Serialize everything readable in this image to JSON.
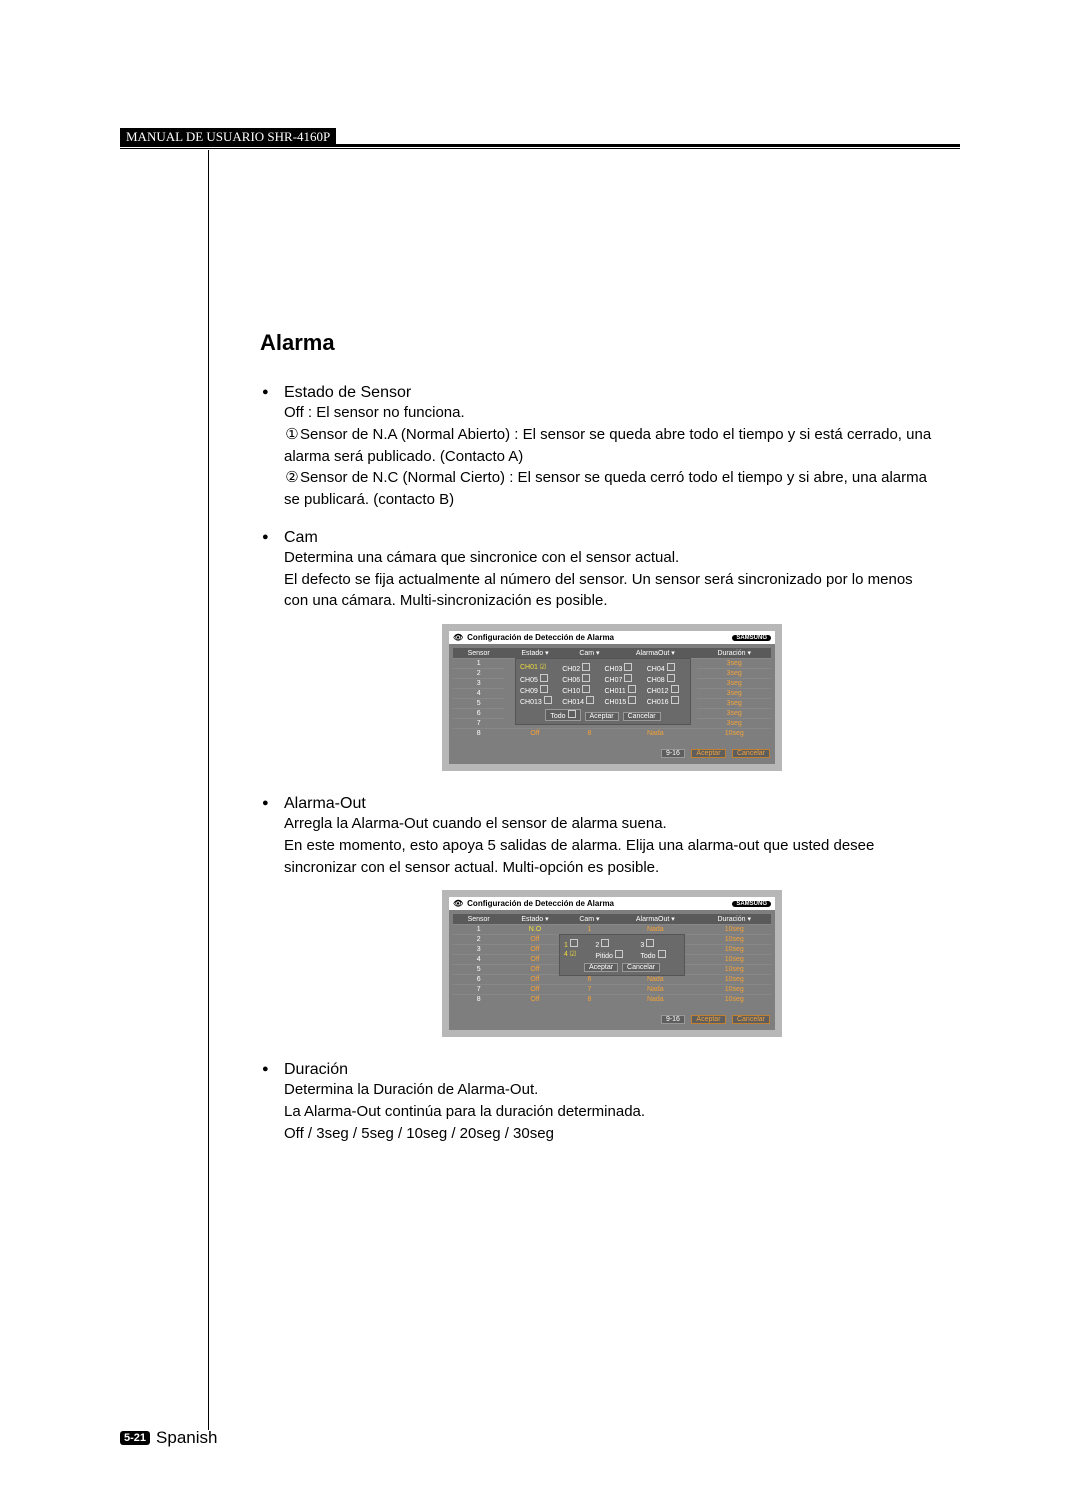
{
  "header": {
    "manual": "MANUAL DE USUARIO SHR-4160P"
  },
  "page": {
    "title": "Alarma",
    "footer_badge": "5-21",
    "footer_lang": "Spanish"
  },
  "sections": {
    "estado": {
      "heading": "Estado de Sensor",
      "off_line": "Off : El sensor no funciona.",
      "enum1_mark": "①",
      "enum1_text": "Sensor de N.A (Normal Abierto) : El sensor se queda abre todo el tiempo y si está cerrado, una alarma será publicado. (Contacto A)",
      "enum2_mark": "②",
      "enum2_text": "Sensor de N.C (Normal Cierto) : El sensor se queda cerró todo el tiempo y si abre, una alarma se publicará. (contacto B)"
    },
    "cam": {
      "heading": "Cam",
      "l1": "Determina una cámara que sincronice con el sensor actual.",
      "l2": "El defecto se fija actualmente al número del sensor. Un sensor será sincronizado por lo menos con una cámara. Multi-sincronización es posible."
    },
    "alarmaout": {
      "heading": "Alarma-Out",
      "l1": "Arregla la Alarma-Out cuando el sensor de alarma suena.",
      "l2": "En este momento, esto apoya 5 salidas de alarma. Elija una alarma-out que usted desee sincronizar con el sensor actual. Multi-opción es posible."
    },
    "duracion": {
      "heading": "Duración",
      "l1": "Determina la Duración de Alarma-Out.",
      "l2": "La Alarma-Out continúa para la duración determinada.",
      "l3": "Off / 3seg / 5seg / 10seg / 20seg / 30seg"
    }
  },
  "screenshot_common": {
    "title": "Configuración de Detección de Alarma",
    "logo": "SAMSUNG",
    "headers": [
      "Sensor",
      "Estado",
      "Cam",
      "AlarmaOut",
      "Duración"
    ],
    "btn_916": "9-16",
    "btn_aceptar": "Aceptar",
    "btn_cancelar": "Cancelar"
  },
  "screenshot1": {
    "rows": [
      {
        "sensor": "1",
        "dur": "3seg"
      },
      {
        "sensor": "2",
        "dur": "3seg"
      },
      {
        "sensor": "3",
        "dur": "3seg"
      },
      {
        "sensor": "4",
        "dur": "3seg"
      },
      {
        "sensor": "5",
        "dur": "3seg"
      },
      {
        "sensor": "6",
        "dur": "3seg"
      },
      {
        "sensor": "7",
        "dur": "3seg"
      },
      {
        "sensor": "8",
        "estado": "Off",
        "cam": "8",
        "out": "Nada",
        "dur": "10seg"
      }
    ],
    "popup_cells": [
      "CH01",
      "CH02",
      "CH03",
      "CH04",
      "CH05",
      "CH06",
      "CH07",
      "CH08",
      "CH09",
      "CH10",
      "CH011",
      "CH012",
      "CH013",
      "CH014",
      "CH015",
      "CH016"
    ],
    "popup_todo": "Todo",
    "popup_aceptar": "Aceptar",
    "popup_cancelar": "Cancelar"
  },
  "screenshot2": {
    "rows": [
      {
        "sensor": "1",
        "estado": "N.O",
        "cam": "1",
        "out": "Nada",
        "dur": "10seg"
      },
      {
        "sensor": "2",
        "estado": "Off",
        "cam": "",
        "out": "",
        "dur": "10seg"
      },
      {
        "sensor": "3",
        "estado": "Off",
        "cam": "",
        "out": "",
        "dur": "10seg"
      },
      {
        "sensor": "4",
        "estado": "Off",
        "cam": "",
        "out": "",
        "dur": "10seg"
      },
      {
        "sensor": "5",
        "estado": "Off",
        "cam": "",
        "out": "",
        "dur": "10seg"
      },
      {
        "sensor": "6",
        "estado": "Off",
        "cam": "6",
        "out": "Nada",
        "dur": "10seg"
      },
      {
        "sensor": "7",
        "estado": "Off",
        "cam": "7",
        "out": "Nada",
        "dur": "10seg"
      },
      {
        "sensor": "8",
        "estado": "Off",
        "cam": "8",
        "out": "Nada",
        "dur": "10seg"
      }
    ],
    "popup_cells": [
      "1",
      "2",
      "3",
      "4",
      "Pitido",
      "Todo"
    ],
    "popup_aceptar": "Aceptar",
    "popup_cancelar": "Cancelar"
  }
}
